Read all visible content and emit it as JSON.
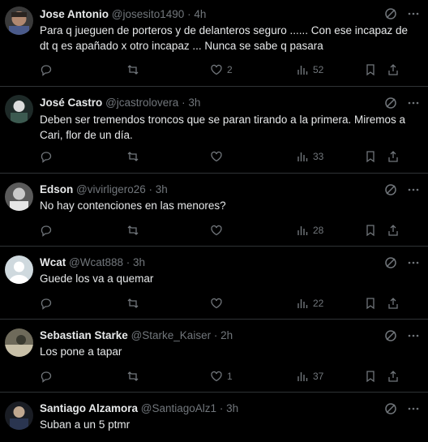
{
  "tweets": [
    {
      "name": "Jose Antonio",
      "handle": "@josesito1490",
      "time": "4h",
      "text": "Para q jueguen de porteros y de delanteros seguro ...... Con ese incapaz de dt q es apañado x otro incapaz ... Nunca se sabe q pasara",
      "likes": "2",
      "views": "52",
      "avatar_color": "#6b5240"
    },
    {
      "name": "José Castro",
      "handle": "@jcastrolovera",
      "time": "3h",
      "text": "Deben ser tremendos troncos que se paran tirando a la primera. Miremos a Cari, flor de un día.",
      "likes": "",
      "views": "33",
      "avatar_color": "#3c5a50"
    },
    {
      "name": "Edson",
      "handle": "@vivirligero26",
      "time": "3h",
      "text": "No hay contenciones en las menores?",
      "likes": "",
      "views": "28",
      "avatar_color": "#8a8a8a"
    },
    {
      "name": "Wcat",
      "handle": "@Wcat888",
      "time": "3h",
      "text": "Guede los va a quemar",
      "likes": "",
      "views": "22",
      "avatar_color": "#cfd9de"
    },
    {
      "name": "Sebastian Starke",
      "handle": "@Starke_Kaiser",
      "time": "2h",
      "text": "Los pone a tapar",
      "likes": "1",
      "views": "37",
      "avatar_color": "#9a9a88"
    },
    {
      "name": "Santiago Alzamora",
      "handle": "@SantiagoAlz1",
      "time": "3h",
      "text": "Suban a un 5 ptmr",
      "likes": "",
      "views": "",
      "avatar_color": "#2a2f3a"
    }
  ],
  "icons": {
    "reply": "reply-icon",
    "retweet": "retweet-icon",
    "like": "heart-icon",
    "views": "views-icon",
    "bookmark": "bookmark-icon",
    "share": "share-icon",
    "grok": "grok-icon",
    "more": "more-icon"
  },
  "colors": {
    "background": "#000000",
    "text": "#e7e9ea",
    "muted": "#71767b",
    "divider": "#2f3336"
  }
}
